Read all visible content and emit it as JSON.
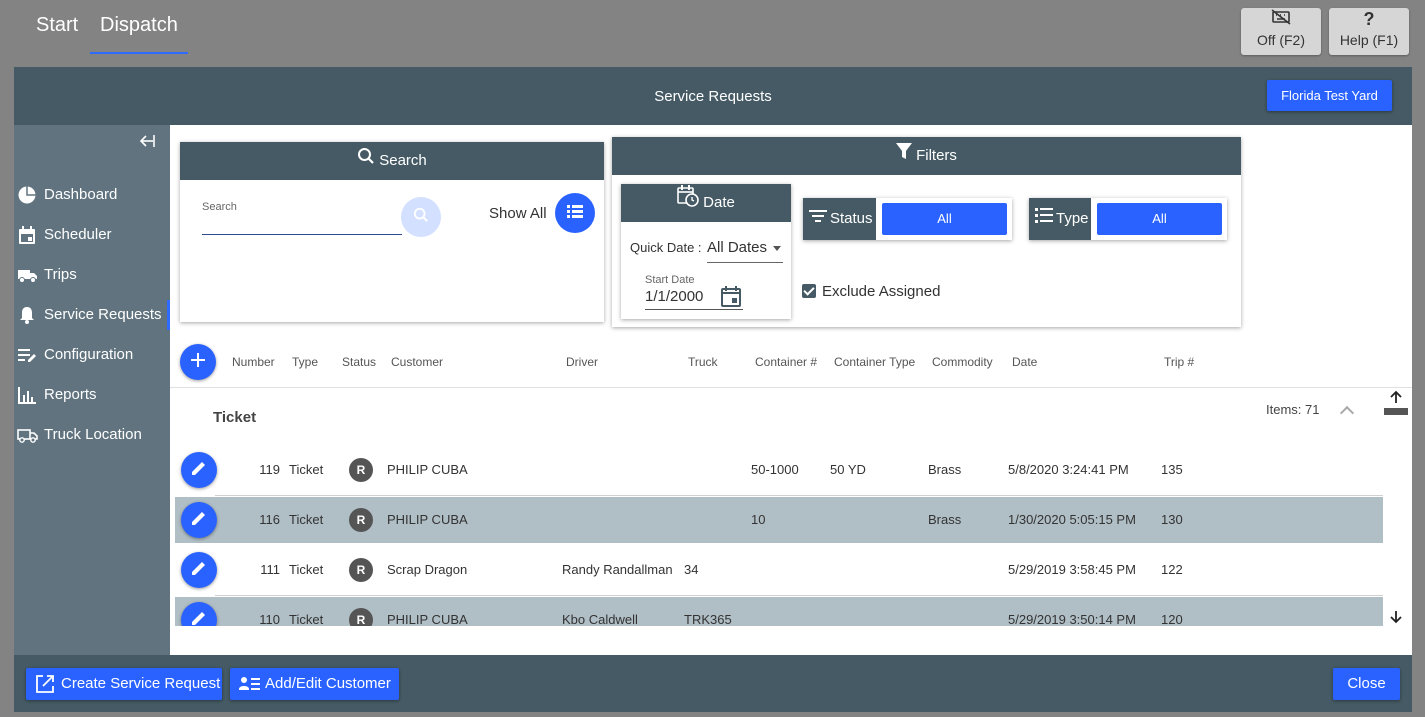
{
  "top_tabs": {
    "start": "Start",
    "dispatch": "Dispatch"
  },
  "top_buttons": {
    "off": "Off (F2)",
    "help": "Help (F1)",
    "help_glyph": "?"
  },
  "header": {
    "title": "Service Requests",
    "yard_button": "Florida Test Yard"
  },
  "sidebar": {
    "items": [
      {
        "label": "Dashboard",
        "icon": "pie-chart-icon"
      },
      {
        "label": "Scheduler",
        "icon": "calendar-icon"
      },
      {
        "label": "Trips",
        "icon": "truck-icon"
      },
      {
        "label": "Service Requests",
        "icon": "bell-icon",
        "active": true
      },
      {
        "label": "Configuration",
        "icon": "edit-list-icon"
      },
      {
        "label": "Reports",
        "icon": "bar-chart-icon"
      },
      {
        "label": "Truck Location",
        "icon": "truck-location-icon"
      }
    ]
  },
  "search": {
    "title": "Search",
    "field_label": "Search",
    "value": "",
    "placeholder": "",
    "show_all": "Show All"
  },
  "filters": {
    "title": "Filters",
    "date": {
      "title": "Date",
      "quick_date_label": "Quick Date :",
      "quick_date_value": "All Dates",
      "start_date_label": "Start Date",
      "start_date_value": "1/1/2000"
    },
    "status": {
      "label": "Status",
      "value": "All"
    },
    "type": {
      "label": "Type",
      "value": "All"
    },
    "exclude_assigned": {
      "label": "Exclude Assigned",
      "checked": true
    }
  },
  "table": {
    "columns": [
      "Number",
      "Type",
      "Status",
      "Customer",
      "Driver",
      "Truck",
      "Container #",
      "Container Type",
      "Commodity",
      "Date",
      "Trip #"
    ],
    "group": {
      "title": "Ticket",
      "items": "Items: 71"
    },
    "rows": [
      {
        "number": "119",
        "type": "Ticket",
        "status": "R",
        "customer": "PHILIP CUBA",
        "driver": "",
        "truck": "",
        "container": "50-1000",
        "container_type": "50 YD",
        "commodity": "Brass",
        "date": "5/8/2020 3:24:41 PM",
        "trip": "135"
      },
      {
        "number": "116",
        "type": "Ticket",
        "status": "R",
        "customer": "PHILIP CUBA",
        "driver": "",
        "truck": "",
        "container": "10",
        "container_type": "",
        "commodity": "Brass",
        "date": "1/30/2020 5:05:15 PM",
        "trip": "130"
      },
      {
        "number": "111",
        "type": "Ticket",
        "status": "R",
        "customer": "Scrap Dragon",
        "driver": "Randy Randallman",
        "truck": "34",
        "container": "",
        "container_type": "",
        "commodity": "",
        "date": "5/29/2019 3:58:45 PM",
        "trip": "122"
      },
      {
        "number": "110",
        "type": "Ticket",
        "status": "R",
        "customer": "PHILIP CUBA",
        "driver": "Kbo Caldwell",
        "truck": "TRK365",
        "container": "",
        "container_type": "",
        "commodity": "",
        "date": "5/29/2019 3:50:14 PM",
        "trip": "120"
      }
    ]
  },
  "footer": {
    "create": "Create Service Request",
    "add_edit": "Add/Edit Customer",
    "close": "Close"
  },
  "colors": {
    "accent": "#2962ff",
    "header": "#455a64",
    "sidebar": "#60737e",
    "row_alt": "#b0bec5"
  }
}
